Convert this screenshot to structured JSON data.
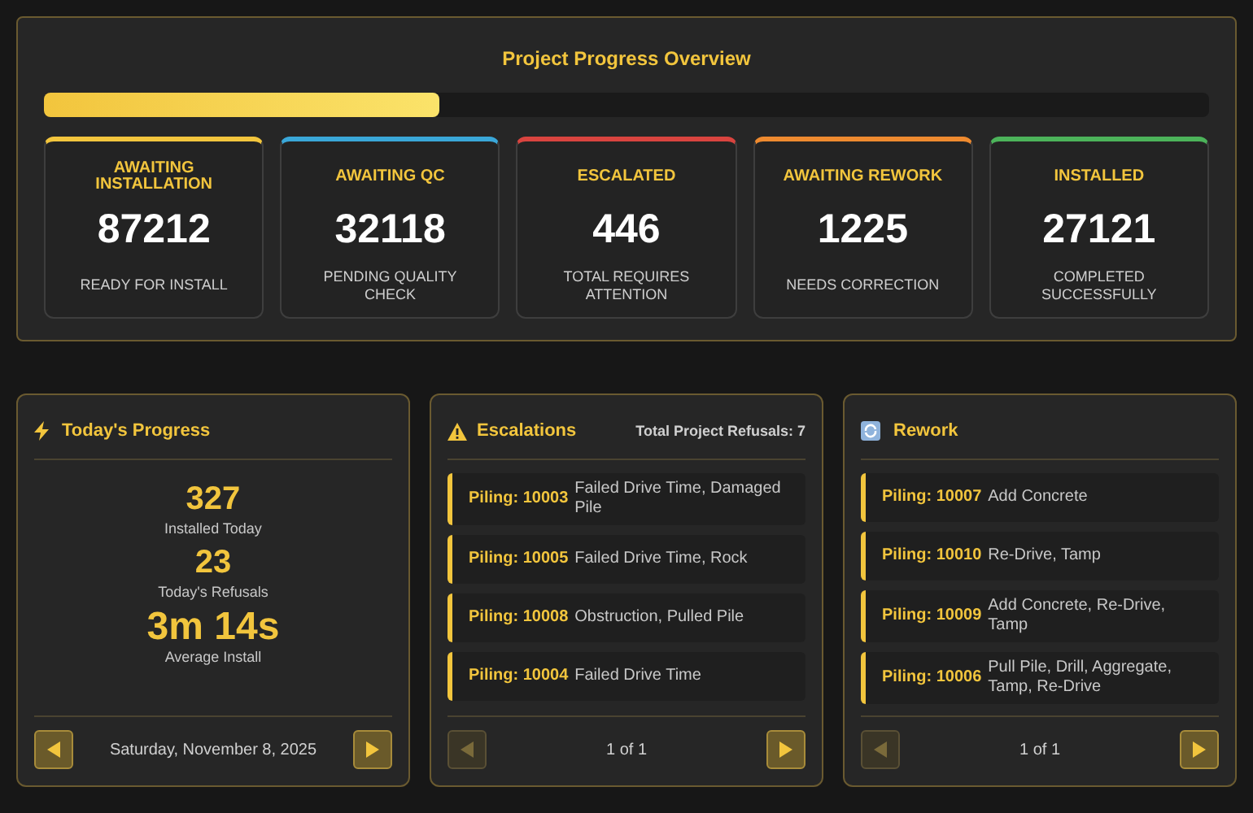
{
  "overview": {
    "title": "Project Progress Overview",
    "level": 0.34,
    "cards": [
      {
        "label": "AWAITING INSTALLATION",
        "value": "87212",
        "caption": "READY FOR INSTALL",
        "color": "#f2c53d"
      },
      {
        "label": "AWAITING QC",
        "value": "32118",
        "caption": "PENDING QUALITY CHECK",
        "color": "#3aa7d8"
      },
      {
        "label": "ESCALATED",
        "value": "446",
        "caption": "TOTAL REQUIRES ATTENTION",
        "color": "#d9443f"
      },
      {
        "label": "AWAITING REWORK",
        "value": "1225",
        "caption": "NEEDS CORRECTION",
        "color": "#ee8a2f"
      },
      {
        "label": "INSTALLED",
        "value": "27121",
        "caption": "COMPLETED SUCCESSFULLY",
        "color": "#4cb35a"
      }
    ]
  },
  "today": {
    "title": "Today's Progress",
    "stats": [
      {
        "value": "327",
        "label": "Installed Today"
      },
      {
        "value": "23",
        "label": "Today's Refusals"
      },
      {
        "value": "3m 14s",
        "label": "Average Install",
        "kind": "large"
      }
    ],
    "footer": {
      "text": "Saturday, November 8, 2025",
      "prev_disabled": false,
      "next_disabled": false
    }
  },
  "escalations": {
    "title": "Escalations",
    "summary": "Total Project Refusals: 7",
    "items": [
      {
        "id": "Piling: 10003",
        "text": "Failed Drive Time, Damaged Pile"
      },
      {
        "id": "Piling: 10005",
        "text": "Failed Drive Time, Rock"
      },
      {
        "id": "Piling: 10008",
        "text": "Obstruction, Pulled Pile"
      },
      {
        "id": "Piling: 10004",
        "text": "Failed Drive Time"
      }
    ],
    "footer": {
      "text": "1 of 1",
      "prev_disabled": true,
      "next_disabled": false
    }
  },
  "rework": {
    "title": "Rework",
    "items": [
      {
        "id": "Piling: 10007",
        "text": "Add Concrete"
      },
      {
        "id": "Piling: 10010",
        "text": "Re-Drive, Tamp"
      },
      {
        "id": "Piling: 10009",
        "text": "Add Concrete, Re-Drive, Tamp"
      },
      {
        "id": "Piling: 10006",
        "text": "Pull Pile, Drill, Aggregate, Tamp, Re-Drive"
      }
    ],
    "footer": {
      "text": "1 of 1",
      "prev_disabled": true,
      "next_disabled": false
    }
  }
}
